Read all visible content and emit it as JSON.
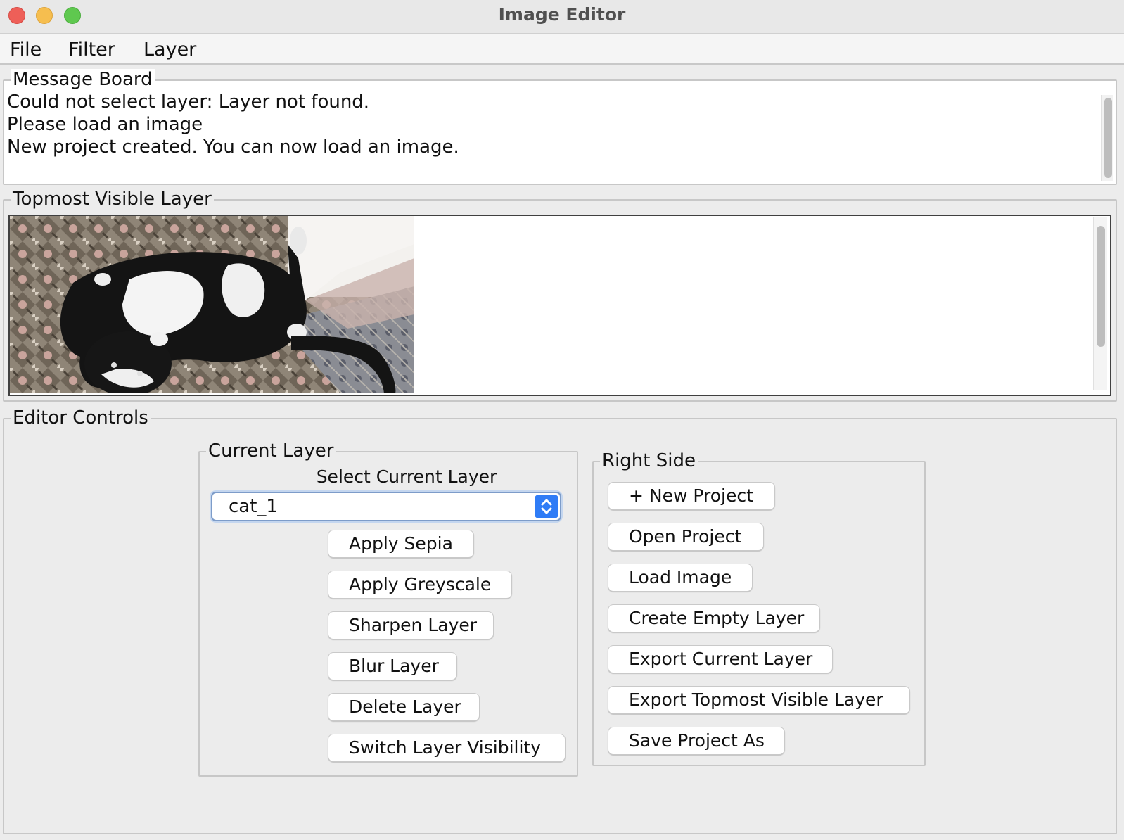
{
  "window": {
    "title": "Image Editor"
  },
  "menubar": {
    "items": [
      {
        "label": "File"
      },
      {
        "label": "Filter"
      },
      {
        "label": "Layer"
      }
    ]
  },
  "message_board": {
    "title": "Message Board",
    "lines": [
      "Could not select layer: Layer not found.",
      "Please load an image",
      "New project created. You can now load an image."
    ]
  },
  "topmost_layer": {
    "title": "Topmost Visible Layer",
    "image": "cat lying upside down on a patterned rug"
  },
  "editor_controls": {
    "title": "Editor Controls",
    "current_layer": {
      "title": "Current Layer",
      "select_label": "Select Current Layer",
      "selected_value": "cat_1",
      "buttons": [
        {
          "label": "Apply Sepia"
        },
        {
          "label": "Apply Greyscale"
        },
        {
          "label": "Sharpen Layer"
        },
        {
          "label": "Blur Layer"
        },
        {
          "label": "Delete Layer"
        },
        {
          "label": "Switch Layer Visibility"
        }
      ]
    },
    "right_side": {
      "title": "Right Side",
      "buttons": [
        {
          "label": "+ New Project"
        },
        {
          "label": "Open Project"
        },
        {
          "label": "Load Image"
        },
        {
          "label": "Create Empty Layer"
        },
        {
          "label": "Export Current Layer"
        },
        {
          "label": "Export Topmost Visible Layer"
        },
        {
          "label": "Save Project As"
        }
      ]
    }
  },
  "colors": {
    "window_bg": "#ececec",
    "accent": "#2f7cf6",
    "close": "#ee5f58",
    "minimize": "#f6be4f",
    "maximize": "#5fc84f"
  }
}
